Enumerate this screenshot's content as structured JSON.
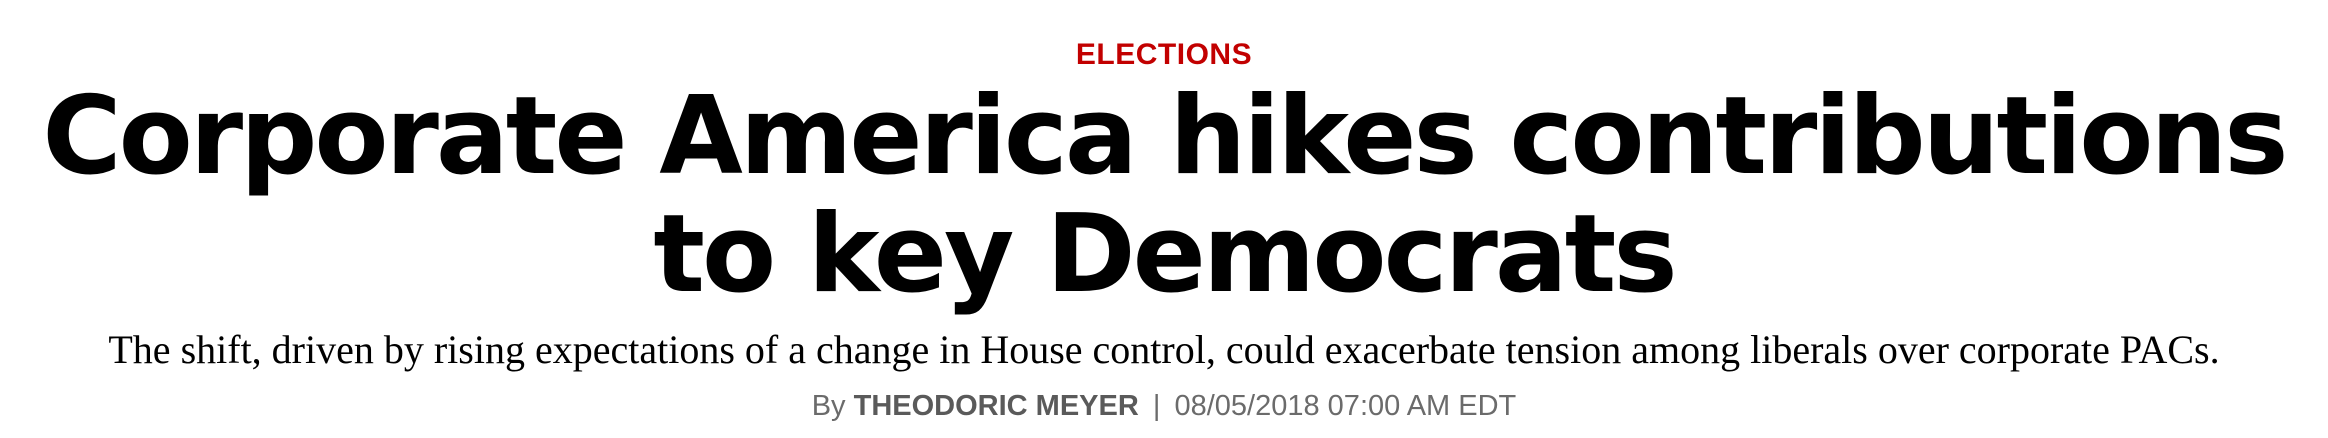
{
  "article": {
    "category": "ELECTIONS",
    "headline": "Corporate America hikes contributions to key Democrats",
    "dek": "The shift, driven by rising expectations of a change in House control, could exacerbate tension among liberals over corporate PACs.",
    "byline": {
      "prefix": "By",
      "author": "THEODORIC MEYER",
      "separator": "|",
      "timestamp": "08/05/2018 07:00 AM EDT"
    }
  },
  "colors": {
    "category": "#c20000",
    "headline": "#000000",
    "byline": "#6b6b6b"
  }
}
